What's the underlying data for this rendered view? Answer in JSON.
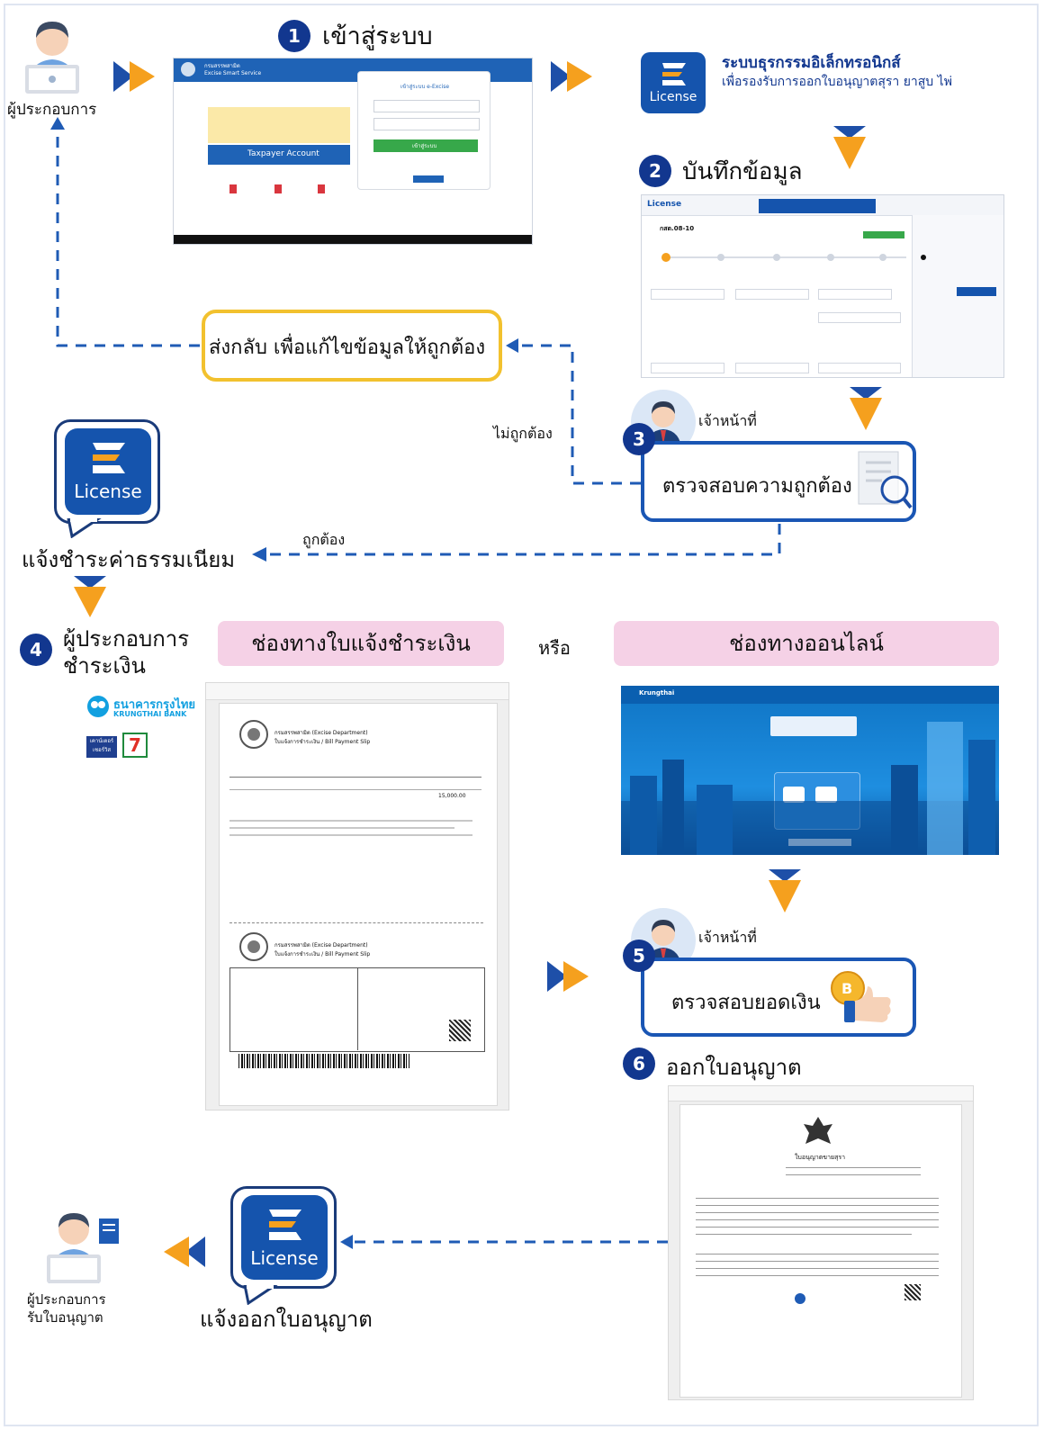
{
  "steps": {
    "s1": {
      "num": "1",
      "title": "เข้าสู่ระบบ"
    },
    "s2": {
      "num": "2",
      "title": "บันทึกข้อมูล"
    },
    "s3": {
      "num": "3",
      "role": "เจ้าหน้าที่",
      "title": "ตรวจสอบความถูกต้อง"
    },
    "s4": {
      "num": "4",
      "title_line1": "ผู้ประกอบการ",
      "title_line2": "ชำระเงิน"
    },
    "s5": {
      "num": "5",
      "role": "เจ้าหน้าที่",
      "title": "ตรวจสอบยอดเงิน"
    },
    "s6": {
      "num": "6",
      "title": "ออกใบอนุญาต"
    }
  },
  "actors": {
    "operator": "ผู้ประกอบการ",
    "operator_receive_line1": "ผู้ประกอบการ",
    "operator_receive_line2": "รับใบอนุญาต"
  },
  "system": {
    "name": "ระบบธุรกรรมอิเล็กทรอนิกส์",
    "description": "เพื่อรองรับการออกใบอนุญาตสุรา ยาสูบ ไพ่",
    "logo_text": "License"
  },
  "flow": {
    "send_back": "ส่งกลับ เพื่อแก้ไขข้อมูลให้ถูกต้อง",
    "incorrect": "ไม่ถูกต้อง",
    "correct": "ถูกต้อง",
    "notify_fee": "แจ้งชำระค่าธรรมเนียม",
    "or": "หรือ",
    "notify_license": "แจ้งออกใบอนุญาต"
  },
  "channels": {
    "slip": "ช่องทางใบแจ้งชำระเงิน",
    "online": "ช่องทางออนไลน์"
  },
  "banks": {
    "ktb_th": "ธนาคารกรุงไทย",
    "ktb_en": "KRUNGTHAI BANK",
    "counter": "เคาน์เตอร์ เซอร์วิส",
    "seven": "7"
  },
  "login_screen": {
    "dept": "กรมสรรพสามิต",
    "app": "Excise Smart Service",
    "panel_title": "เข้าสู่ระบบ e-Excise",
    "taxpayer": "Taxpayer Account",
    "login_btn": "เข้าสู่ระบบ"
  },
  "form_screen": {
    "brand": "License",
    "form_code": "กสต.08-10"
  },
  "slip": {
    "dept": "กรมสรรพสามิต (Excise Department)",
    "title": "ใบแจ้งการชำระเงิน / Bill Payment Slip",
    "amount": "15,000.00",
    "part2_title": "ใบแจ้งการชำระเงิน / Bill Payment Slip"
  },
  "online_screen": {
    "brand": "Krungthai"
  },
  "license_doc": {
    "title": "ใบอนุญาตขายสุรา"
  },
  "colors": {
    "navy": "#12378f",
    "blue": "#1a56b4",
    "orange": "#f5a01e",
    "yellow": "#f2c12e",
    "pink": "#f5d1e6",
    "dash": "#1f5bb5"
  }
}
